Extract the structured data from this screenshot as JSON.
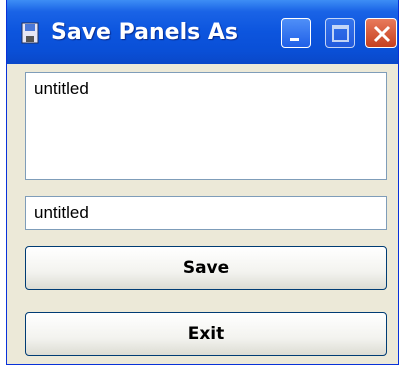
{
  "window": {
    "title": "Save Panels As",
    "icons": {
      "app": "floppy-disk-icon",
      "minimize": "minimize-icon",
      "maximize": "maximize-icon",
      "close": "close-icon"
    }
  },
  "form": {
    "list_text": "untitled",
    "filename_value": "untitled",
    "save_label": "Save",
    "exit_label": "Exit"
  }
}
